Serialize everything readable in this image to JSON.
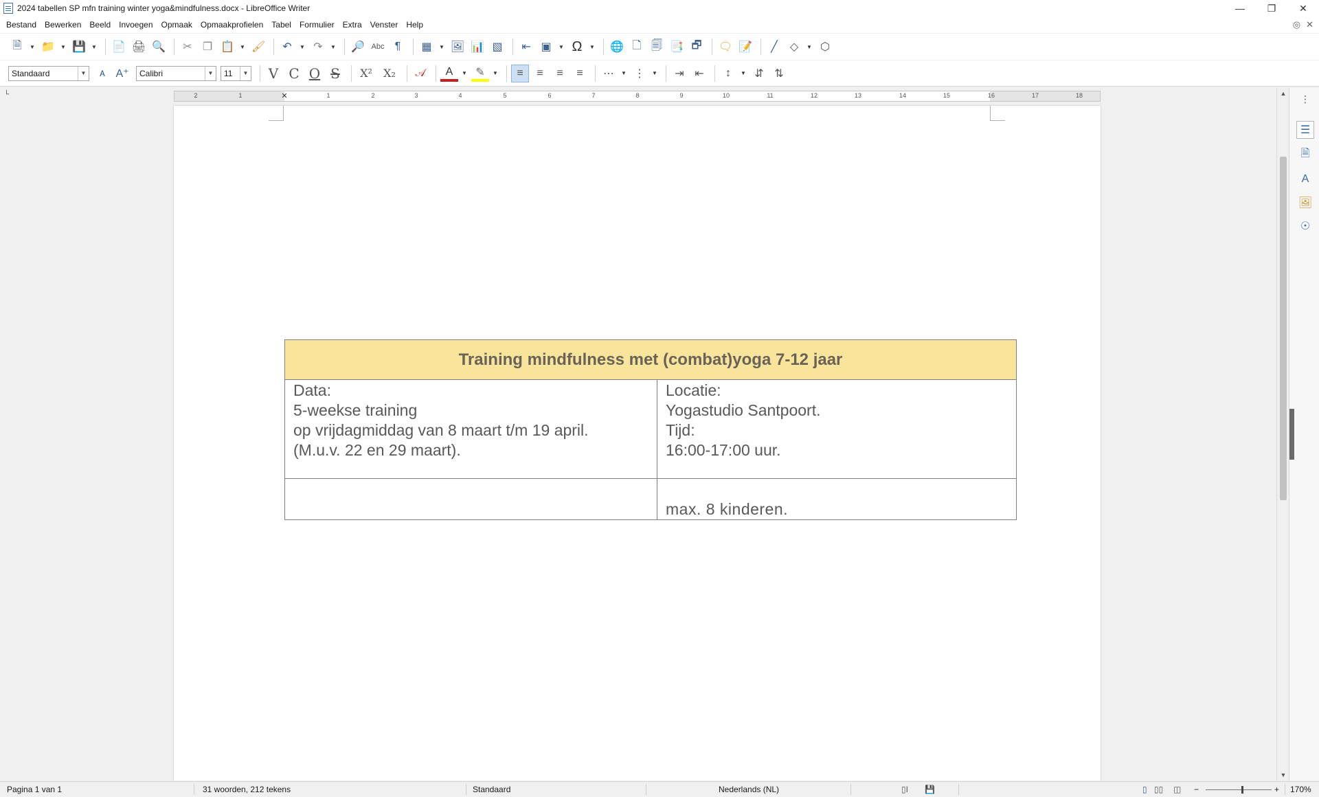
{
  "window": {
    "title": "2024 tabellen SP mfn training winter yoga&mindfulness.docx - LibreOffice Writer",
    "controls": {
      "minimize": "—",
      "restore": "❐",
      "close": "✕"
    }
  },
  "menu": {
    "items": [
      "Bestand",
      "Bewerken",
      "Beeld",
      "Invoegen",
      "Opmaak",
      "Opmaakprofielen",
      "Tabel",
      "Formulier",
      "Extra",
      "Venster",
      "Help"
    ]
  },
  "formatting": {
    "paragraph_style": "Standaard",
    "font_name": "Calibri",
    "font_size": "11",
    "bold_glyph": "V",
    "italic_glyph": "C",
    "underline_glyph": "O",
    "strike_glyph": "S",
    "superscript_glyph": "X²",
    "subscript_glyph": "X₂"
  },
  "ruler": {
    "corner": "└",
    "ticks": [
      "2",
      "1",
      "1",
      "2",
      "3",
      "4",
      "5",
      "6",
      "7",
      "8",
      "9",
      "10",
      "11",
      "12",
      "13",
      "14",
      "15",
      "16",
      "17",
      "18"
    ]
  },
  "document": {
    "table": {
      "header": "Training mindfulness met (combat)yoga 7-12 jaar",
      "left_cell": [
        "Data:",
        "5-weekse training",
        "op vrijdagmiddag van 8 maart t/m 19 april.",
        "(M.u.v. 22 en 29 maart)."
      ],
      "right_cell": [
        "Locatie:",
        "Yogastudio Santpoort.",
        "Tijd:",
        "16:00-17:00 uur."
      ],
      "bottom_right": "max. 8 kinderen."
    }
  },
  "status": {
    "page": "Pagina 1 van 1",
    "words": "31 woorden, 212 tekens",
    "page_style": "Standaard",
    "language": "Nederlands (NL)",
    "zoom": "170%",
    "zoom_minus": "−",
    "zoom_plus": "+"
  },
  "colors": {
    "table_header_bg": "#f9e49c",
    "table_text": "#595959",
    "accent_icon": "#3a5f9a"
  }
}
